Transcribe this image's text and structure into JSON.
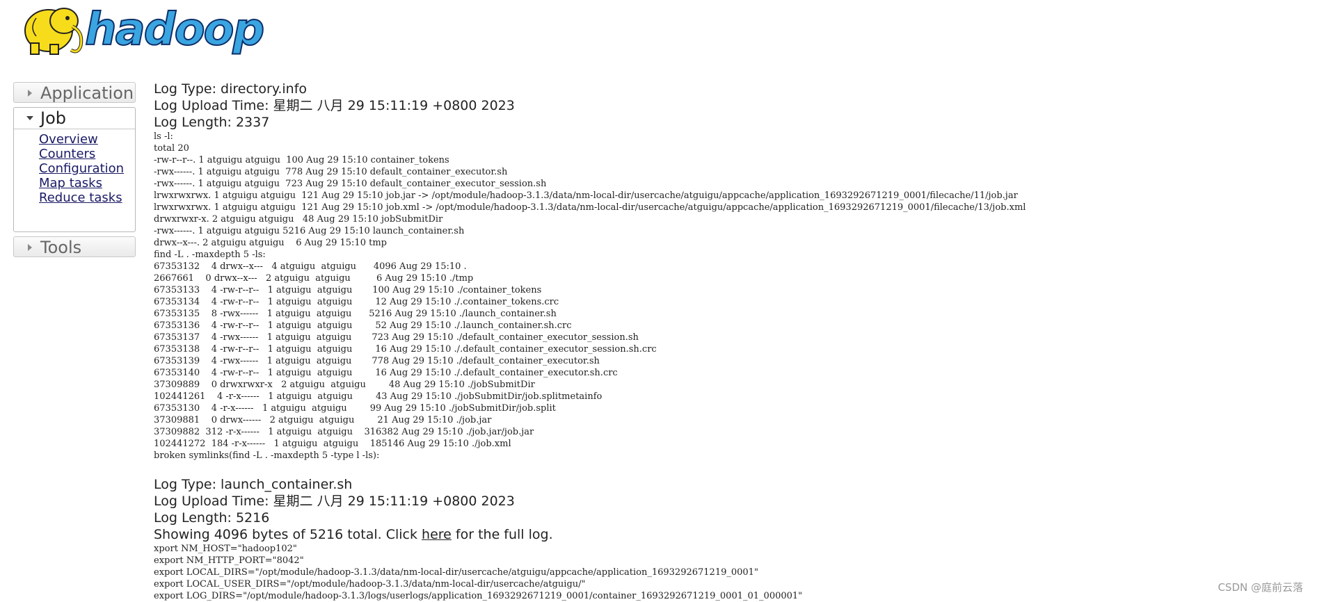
{
  "logo": {
    "text": "hadoop"
  },
  "sidebar": {
    "application_label": "Application",
    "job_label": "Job",
    "job_links": [
      "Overview",
      "Counters",
      "Configuration",
      "Map tasks",
      "Reduce tasks"
    ],
    "tools_label": "Tools"
  },
  "logs": [
    {
      "type": "Log Type: directory.info",
      "upload_time": "Log Upload Time: 星期二 八月 29 15:11:19 +0800 2023",
      "length": "Log Length: 2337",
      "lines": [
        "ls -l:",
        "total 20",
        "-rw-r--r--. 1 atguigu atguigu  100 Aug 29 15:10 container_tokens",
        "-rwx------. 1 atguigu atguigu  778 Aug 29 15:10 default_container_executor.sh",
        "-rwx------. 1 atguigu atguigu  723 Aug 29 15:10 default_container_executor_session.sh",
        "lrwxrwxrwx. 1 atguigu atguigu  121 Aug 29 15:10 job.jar -> /opt/module/hadoop-3.1.3/data/nm-local-dir/usercache/atguigu/appcache/application_1693292671219_0001/filecache/11/job.jar",
        "lrwxrwxrwx. 1 atguigu atguigu  121 Aug 29 15:10 job.xml -> /opt/module/hadoop-3.1.3/data/nm-local-dir/usercache/atguigu/appcache/application_1693292671219_0001/filecache/13/job.xml",
        "drwxrwxr-x. 2 atguigu atguigu   48 Aug 29 15:10 jobSubmitDir",
        "-rwx------. 1 atguigu atguigu 5216 Aug 29 15:10 launch_container.sh",
        "drwx--x---. 2 atguigu atguigu    6 Aug 29 15:10 tmp",
        "find -L . -maxdepth 5 -ls:",
        "67353132    4 drwx--x---   4 atguigu  atguigu      4096 Aug 29 15:10 .",
        "2667661    0 drwx--x---   2 atguigu  atguigu         6 Aug 29 15:10 ./tmp",
        "67353133    4 -rw-r--r--   1 atguigu  atguigu       100 Aug 29 15:10 ./container_tokens",
        "67353134    4 -rw-r--r--   1 atguigu  atguigu        12 Aug 29 15:10 ./.container_tokens.crc",
        "67353135    8 -rwx------   1 atguigu  atguigu      5216 Aug 29 15:10 ./launch_container.sh",
        "67353136    4 -rw-r--r--   1 atguigu  atguigu        52 Aug 29 15:10 ./.launch_container.sh.crc",
        "67353137    4 -rwx------   1 atguigu  atguigu       723 Aug 29 15:10 ./default_container_executor_session.sh",
        "67353138    4 -rw-r--r--   1 atguigu  atguigu        16 Aug 29 15:10 ./.default_container_executor_session.sh.crc",
        "67353139    4 -rwx------   1 atguigu  atguigu       778 Aug 29 15:10 ./default_container_executor.sh",
        "67353140    4 -rw-r--r--   1 atguigu  atguigu        16 Aug 29 15:10 ./.default_container_executor.sh.crc",
        "37309889    0 drwxrwxr-x   2 atguigu  atguigu        48 Aug 29 15:10 ./jobSubmitDir",
        "102441261    4 -r-x------   1 atguigu  atguigu        43 Aug 29 15:10 ./jobSubmitDir/job.splitmetainfo",
        "67353130    4 -r-x------   1 atguigu  atguigu        99 Aug 29 15:10 ./jobSubmitDir/job.split",
        "37309881    0 drwx------   2 atguigu  atguigu        21 Aug 29 15:10 ./job.jar",
        "37309882  312 -r-x------   1 atguigu  atguigu    316382 Aug 29 15:10 ./job.jar/job.jar",
        "102441272  184 -r-x------   1 atguigu  atguigu    185146 Aug 29 15:10 ./job.xml",
        "broken symlinks(find -L . -maxdepth 5 -type l -ls):"
      ]
    },
    {
      "type": "Log Type: launch_container.sh",
      "upload_time": "Log Upload Time: 星期二 八月 29 15:11:19 +0800 2023",
      "length": "Log Length: 5216",
      "showing_prefix": "Showing 4096 bytes of 5216 total. Click ",
      "showing_link": "here",
      "showing_suffix": " for the full log.",
      "lines": [
        "xport NM_HOST=\"hadoop102\"",
        "export NM_HTTP_PORT=\"8042\"",
        "export LOCAL_DIRS=\"/opt/module/hadoop-3.1.3/data/nm-local-dir/usercache/atguigu/appcache/application_1693292671219_0001\"",
        "export LOCAL_USER_DIRS=\"/opt/module/hadoop-3.1.3/data/nm-local-dir/usercache/atguigu/\"",
        "export LOG_DIRS=\"/opt/module/hadoop-3.1.3/logs/userlogs/application_1693292671219_0001/container_1693292671219_0001_01_000001\""
      ]
    }
  ],
  "watermark": "CSDN @庭前云落"
}
